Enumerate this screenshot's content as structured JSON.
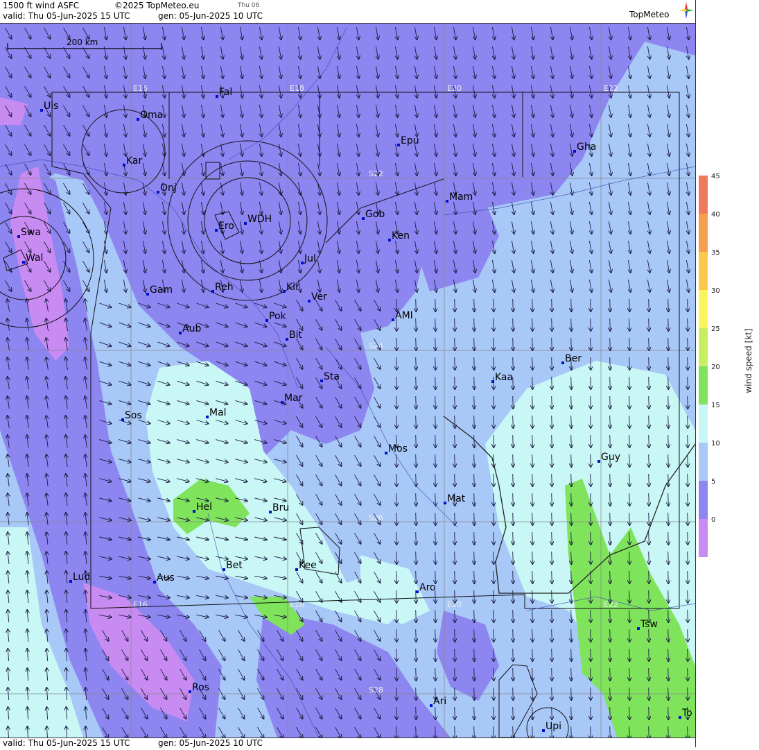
{
  "header": {
    "product": "1500 ft wind ASFC",
    "copyright": "©2025 TopMeteo.eu",
    "day_short": "Thu 06",
    "valid": "valid:  Thu  05-Jun-2025  15 UTC",
    "generated": "gen: 05-Jun-2025 10 UTC",
    "brand": "TopMeteo"
  },
  "footer": {
    "valid": "valid:  Thu  05-Jun-2025  15 UTC",
    "generated": "gen: 05-Jun-2025 10 UTC"
  },
  "scale_bar": {
    "label": "200 km"
  },
  "legend": {
    "title": "wind speed [kt]",
    "ticks": [
      "45",
      "40",
      "35",
      "30",
      "25",
      "20",
      "15",
      "10",
      "5",
      "0"
    ],
    "colors": [
      "#f07a5e",
      "#f5a04e",
      "#fac94b",
      "#faf55f",
      "#c8ef62",
      "#7fe35c",
      "#c8f7f5",
      "#a8c8f8",
      "#8d85f0",
      "#c88bf2"
    ]
  },
  "grid_labels": {
    "lon": [
      "E16",
      "E18",
      "E20",
      "E22"
    ],
    "lat": [
      "S22",
      "S24",
      "S26",
      "S28"
    ]
  },
  "places": [
    {
      "name": "Uis"
    },
    {
      "name": "Oma"
    },
    {
      "name": "Fal"
    },
    {
      "name": "Epu"
    },
    {
      "name": "Gha"
    },
    {
      "name": "Kar"
    },
    {
      "name": "Onj"
    },
    {
      "name": "Mam"
    },
    {
      "name": "Swa"
    },
    {
      "name": "Wal"
    },
    {
      "name": "Ero"
    },
    {
      "name": "WDH"
    },
    {
      "name": "Gob"
    },
    {
      "name": "Ken"
    },
    {
      "name": "Jul"
    },
    {
      "name": "Gam"
    },
    {
      "name": "Reh"
    },
    {
      "name": "Kir"
    },
    {
      "name": "Ver"
    },
    {
      "name": "Pok"
    },
    {
      "name": "AMI"
    },
    {
      "name": "Aub"
    },
    {
      "name": "Bit"
    },
    {
      "name": "Ber"
    },
    {
      "name": "Sta"
    },
    {
      "name": "Kaa"
    },
    {
      "name": "Mar"
    },
    {
      "name": "Sos"
    },
    {
      "name": "Mal"
    },
    {
      "name": "Mos"
    },
    {
      "name": "Guy"
    },
    {
      "name": "Mat"
    },
    {
      "name": "Hel"
    },
    {
      "name": "Bru"
    },
    {
      "name": "Bet"
    },
    {
      "name": "Kee"
    },
    {
      "name": "Lud"
    },
    {
      "name": "Aus"
    },
    {
      "name": "Aro"
    },
    {
      "name": "Tsw"
    },
    {
      "name": "Ros"
    },
    {
      "name": "Ari"
    },
    {
      "name": "To"
    },
    {
      "name": "Upi"
    }
  ]
}
